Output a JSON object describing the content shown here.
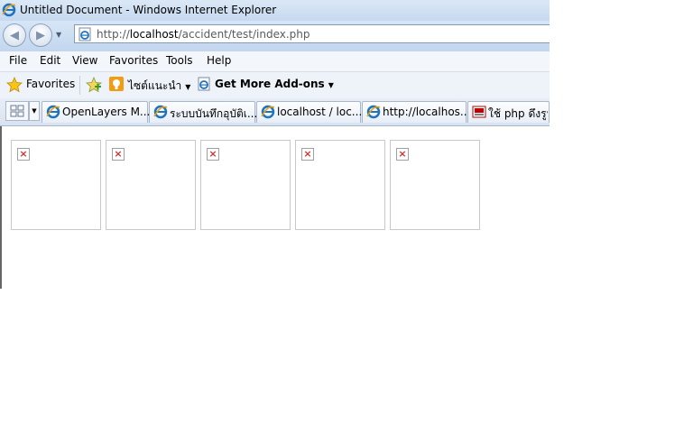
{
  "window": {
    "title": "Untitled Document - Windows Internet Explorer"
  },
  "address_bar": {
    "url_prefix": "http://",
    "url_host": "localhost",
    "url_path": "/accident/test/index.php"
  },
  "menu": {
    "items": [
      "File",
      "Edit",
      "View",
      "Favorites",
      "Tools",
      "Help"
    ]
  },
  "favorites_bar": {
    "favorites_label": "Favorites",
    "suggested_sites_label": "ไซต์แนะนำ",
    "addons_label": "Get More Add-ons"
  },
  "tabs": [
    {
      "label": "OpenLayers M..."
    },
    {
      "label": "ระบบบันทึกอุบัติเ..."
    },
    {
      "label": "localhost / loc..."
    },
    {
      "label": "http://localhos..."
    },
    {
      "label": "ใช้ php ดึงรูปภ"
    }
  ],
  "content": {
    "broken_images": [
      {
        "id": 1
      },
      {
        "id": 2
      },
      {
        "id": 3
      },
      {
        "id": 4
      },
      {
        "id": 5
      }
    ]
  },
  "colors": {
    "chrome_blue": "#c6d9ef",
    "broken_x": "#d03030"
  }
}
